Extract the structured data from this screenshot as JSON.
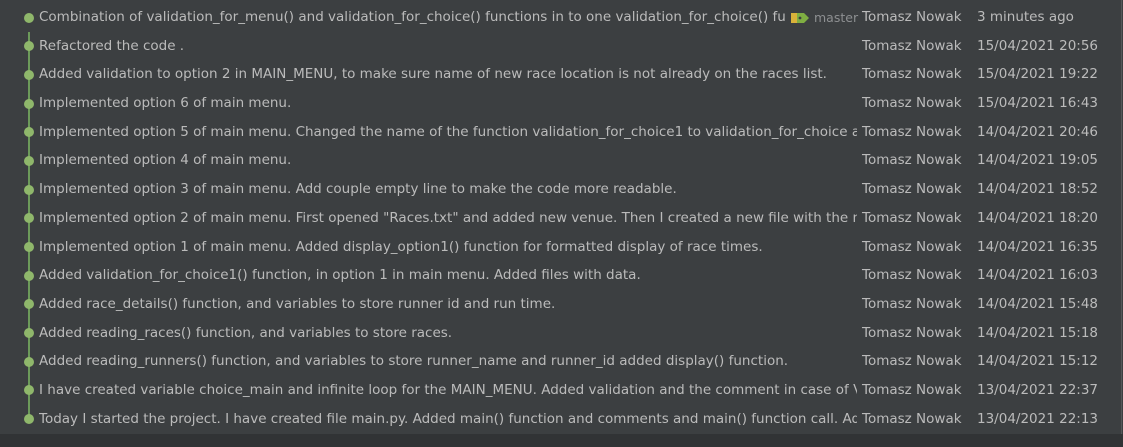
{
  "branch_label": "master",
  "commits": [
    {
      "message": "Combination of validation_for_menu() and validation_for_choice() functions in to one validation_for_choice() function",
      "author": "Tomasz Nowak",
      "date": "3 minutes ago"
    },
    {
      "message": "Refactored the code .",
      "author": "Tomasz Nowak",
      "date": "15/04/2021 20:56"
    },
    {
      "message": "Added validation to option 2 in MAIN_MENU, to make sure name of new race location is not already on the races list.",
      "author": "Tomasz Nowak",
      "date": "15/04/2021 19:22"
    },
    {
      "message": "Implemented option 6 of main menu.",
      "author": "Tomasz Nowak",
      "date": "15/04/2021 16:43"
    },
    {
      "message": "Implemented option 5 of main menu. Changed the name of the function validation_for_choice1 to validation_for_choice and",
      "author": "Tomasz Nowak",
      "date": "14/04/2021 20:46"
    },
    {
      "message": "Implemented option 4 of main menu.",
      "author": "Tomasz Nowak",
      "date": "14/04/2021 19:05"
    },
    {
      "message": "Implemented option 3 of main menu. Add couple empty line to make the code more readable.",
      "author": "Tomasz Nowak",
      "date": "14/04/2021 18:52"
    },
    {
      "message": "Implemented option 2 of main menu. First opened \"Races.txt\" and added new venue. Then I created a new file with the name",
      "author": "Tomasz Nowak",
      "date": "14/04/2021 18:20"
    },
    {
      "message": "Implemented option 1 of main menu. Added display_option1() function for formatted display of race times.",
      "author": "Tomasz Nowak",
      "date": "14/04/2021 16:35"
    },
    {
      "message": "Added validation_for_choice1() function, in option 1 in main menu. Added files with data.",
      "author": "Tomasz Nowak",
      "date": "14/04/2021 16:03"
    },
    {
      "message": "Added race_details() function, and variables to store runner id and run time.",
      "author": "Tomasz Nowak",
      "date": "14/04/2021 15:48"
    },
    {
      "message": "Added reading_races() function, and variables to store races.",
      "author": "Tomasz Nowak",
      "date": "14/04/2021 15:18"
    },
    {
      "message": "Added reading_runners() function, and variables to store runner_name and runner_id added display() function.",
      "author": "Tomasz Nowak",
      "date": "14/04/2021 15:12"
    },
    {
      "message": "I have created variable choice_main and infinite loop for the MAIN_MENU. Added validation and the comment in case of Va",
      "author": "Tomasz Nowak",
      "date": "13/04/2021 22:37"
    },
    {
      "message": "Today I started the project. I have created file main.py. Added main() function and comments and main() function call. Adde",
      "author": "Tomasz Nowak",
      "date": "13/04/2021 22:13"
    }
  ]
}
